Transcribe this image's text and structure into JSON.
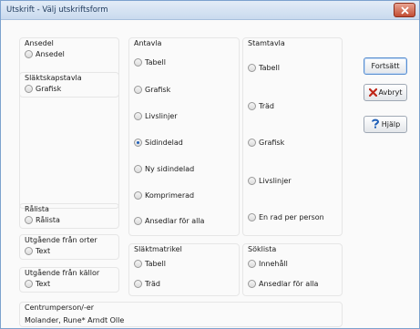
{
  "window": {
    "title": "Utskrift - Välj utskriftsform"
  },
  "ansedel": {
    "legend": "Ansedel",
    "option": "Ansedel"
  },
  "slaktskapstavla": {
    "legend": "Släktskapstavla",
    "option": "Grafisk"
  },
  "antavla": {
    "legend": "Antavla",
    "options": [
      "Tabell",
      "Grafisk",
      "Livslinjer",
      "Sidindelad",
      "Ny sidindelad",
      "Komprimerad",
      "Ansedlar för alla"
    ],
    "selected": "Sidindelad"
  },
  "stamtavla": {
    "legend": "Stamtavla",
    "options": [
      "Tabell",
      "Träd",
      "Grafisk",
      "Livslinjer",
      "En rad per person"
    ]
  },
  "ralista": {
    "legend": "Rålista",
    "option": "Rålista"
  },
  "orter": {
    "legend": "Utgående från orter",
    "option": "Text"
  },
  "kallor": {
    "legend": "Utgående från källor",
    "option": "Text"
  },
  "slaktmatrikel": {
    "legend": "Släktmatrikel",
    "options": [
      "Tabell",
      "Träd"
    ]
  },
  "soklista": {
    "legend": "Söklista",
    "options": [
      "Innehåll",
      "Ansedlar för alla"
    ]
  },
  "centrumperson": {
    "legend": "Centrumperson/-er",
    "value": "Molander, Rune* Arndt Olle"
  },
  "buttons": {
    "continue": "Fortsätt",
    "cancel": "Avbryt",
    "help": "Hjälp"
  },
  "colors": {
    "title_bar": "#c9daee",
    "close_button": "#c24d33",
    "selected_radio": "#1f5fb8"
  }
}
